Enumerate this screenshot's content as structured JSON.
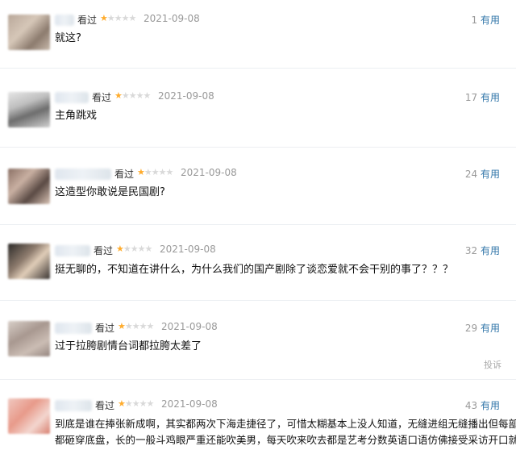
{
  "reviews": [
    {
      "status": "看过",
      "date": "2021-09-08",
      "votes": "1",
      "useful": "有用",
      "stars": 1,
      "content": "就这?"
    },
    {
      "status": "看过",
      "date": "2021-09-08",
      "votes": "17",
      "useful": "有用",
      "stars": 1,
      "content": "主角跳戏"
    },
    {
      "status": "看过",
      "date": "2021-09-08",
      "votes": "24",
      "useful": "有用",
      "stars": 1,
      "content": "这造型你敢说是民国剧?"
    },
    {
      "status": "看过",
      "date": "2021-09-08",
      "votes": "32",
      "useful": "有用",
      "stars": 1,
      "content": "挺无聊的，不知道在讲什么，为什么我们的国产剧除了谈恋爱就不会干别的事了？？？"
    },
    {
      "status": "看过",
      "date": "2021-09-08",
      "votes": "29",
      "useful": "有用",
      "stars": 1,
      "content": "过于拉胯剧情台词都拉胯太差了",
      "report": "投诉"
    },
    {
      "status": "看过",
      "date": "2021-09-08",
      "votes": "43",
      "useful": "有用",
      "stars": 1,
      "content_line1": "到底是谁在捧张新成啊，其实都两次下海走捷径了，可惜太糊基本上没人知道，无缝进组无缝播出但每部剧",
      "content_line2": "都砸穿底盘，长的一般斗鸡眼严重还能吹美男，每天吹来吹去都是艺考分数英语口语仿佛接受采访开口就是"
    }
  ],
  "colors": {
    "star": "#ffac2d",
    "useful": "#3377aa",
    "date": "#999999"
  }
}
